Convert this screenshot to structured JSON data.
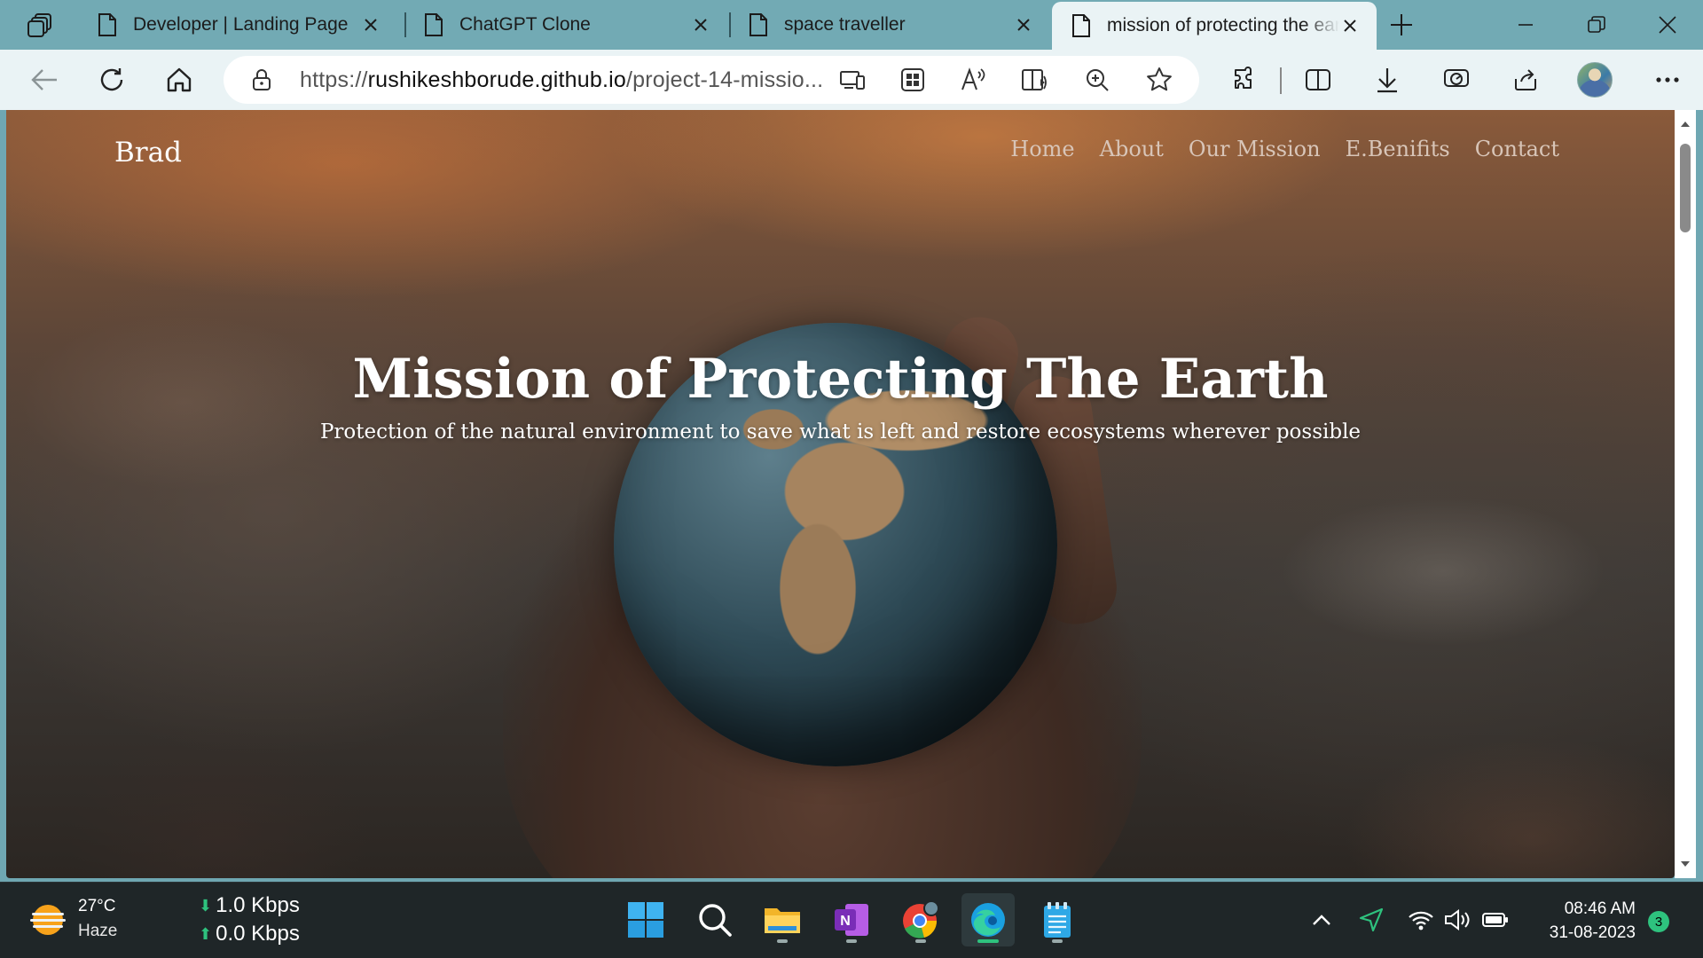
{
  "browser": {
    "tabs": [
      {
        "title": "Developer | Landing Page",
        "active": false
      },
      {
        "title": "ChatGPT Clone",
        "active": false
      },
      {
        "title": "space traveller",
        "active": false
      },
      {
        "title": "mission of protecting the earth",
        "active": true
      }
    ],
    "address": {
      "scheme": "https://",
      "host": "rushikeshborude.github.io",
      "path": "/project-14-missio..."
    }
  },
  "page": {
    "brand": "Brad",
    "nav": [
      "Home",
      "About",
      "Our Mission",
      "E.Benifits",
      "Contact"
    ],
    "hero_title": "Mission of Protecting The Earth",
    "hero_subtitle": "Protection of the natural environment to save what is left and restore ecosystems wherever possible"
  },
  "taskbar": {
    "weather": {
      "temp": "27°C",
      "condition": "Haze"
    },
    "network": {
      "down": "1.0 Kbps",
      "up": "0.0 Kbps"
    },
    "clock": {
      "time": "08:46 AM",
      "date": "31-08-2023"
    },
    "notification_count": "3",
    "apps": [
      "start-icon",
      "search-icon",
      "file-explorer-icon",
      "onenote-icon",
      "chrome-icon",
      "edge-icon",
      "notepad-icon"
    ]
  },
  "colors": {
    "tabbar": "#72aab4",
    "toolbar": "#eaf3f5",
    "accent_green": "#2ec27e",
    "taskbar": "#1f2628"
  }
}
